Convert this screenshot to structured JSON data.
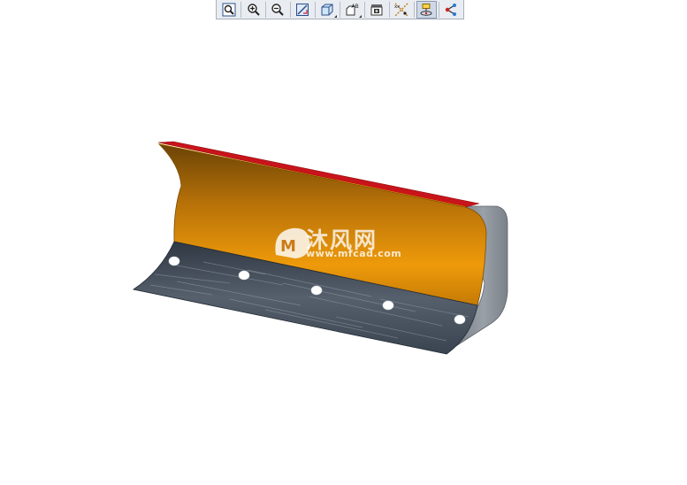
{
  "toolbar": {
    "buttons": [
      {
        "icon": "refit-icon",
        "title": "Refit"
      },
      {
        "icon": "zoom-in-icon",
        "title": "Zoom In"
      },
      {
        "icon": "zoom-out-icon",
        "title": "Zoom Out"
      },
      {
        "icon": "repaint-icon",
        "title": "Repaint"
      },
      {
        "icon": "display-style-icon",
        "title": "Display Style"
      },
      {
        "icon": "saved-views-icon",
        "title": "Saved Orientations"
      },
      {
        "icon": "view-manager-icon",
        "title": "View Manager"
      },
      {
        "icon": "datum-display-icon",
        "title": "Datum Display"
      },
      {
        "icon": "spin-center-icon",
        "title": "Spin Center"
      },
      {
        "icon": "annotation-display-icon",
        "title": "Annotation Display"
      }
    ],
    "active_index": 8
  },
  "model": {
    "name": "snow-plow-blade",
    "colors": {
      "moldboard": "#e8960a",
      "top_edge": "#d11a1a",
      "side_plate": "#8a9099",
      "cutting_edge": "#4a5460",
      "bolt_holes": "#ffffff"
    },
    "bolt_hole_count": 5
  },
  "watermark": {
    "title": "沐风网",
    "url": "www.mfcad.com"
  }
}
